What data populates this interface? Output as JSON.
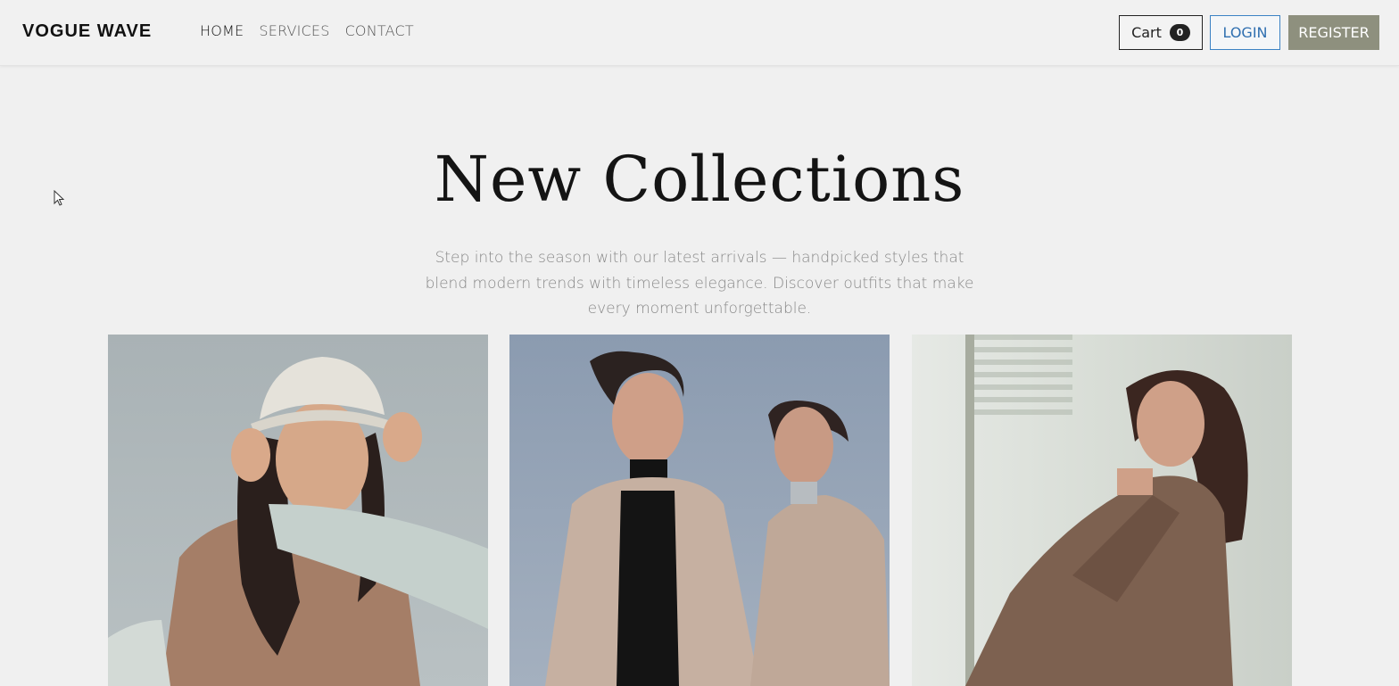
{
  "brand": {
    "name": "VOGUE WAVE"
  },
  "nav": {
    "items": [
      {
        "label": "HOME",
        "active": true
      },
      {
        "label": "SERVICES",
        "active": false
      },
      {
        "label": "CONTACT",
        "active": false
      }
    ]
  },
  "actions": {
    "cart_label": "Cart",
    "cart_count": "0",
    "login_label": "LOGIN",
    "register_label": "REGISTER"
  },
  "hero": {
    "title": "New Collections",
    "subtitle": "Step into the season with our latest arrivals — handpicked styles that blend modern trends with timeless elegance. Discover outfits that make every moment unforgettable."
  },
  "collection": {
    "images": [
      {
        "name": "model-bucket-hat-photo"
      },
      {
        "name": "two-models-trench-coats-photo"
      },
      {
        "name": "model-plaid-blazer-photo"
      }
    ]
  },
  "colors": {
    "background": "#f0f0f0",
    "login_border": "#3b82c4",
    "register_bg": "#8e907e",
    "subtitle": "#888888"
  }
}
